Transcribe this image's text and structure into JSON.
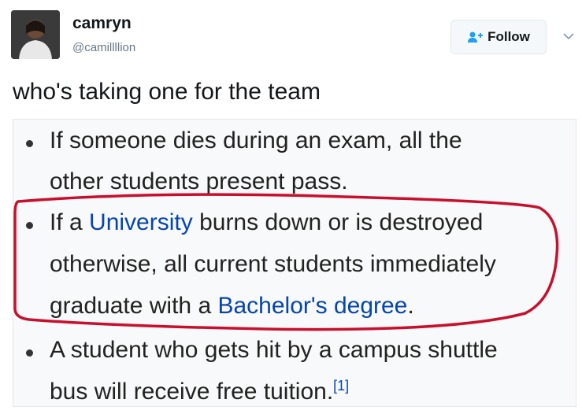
{
  "user": {
    "name": "camryn",
    "handle": "@camillllion"
  },
  "follow_label": "Follow",
  "tweet_text": "who's taking one for the team",
  "icons": {
    "follow": "add-person-icon",
    "menu": "chevron-down-icon"
  },
  "colors": {
    "link": "#0645ad",
    "circle": "#c8102e",
    "handle": "#657786"
  },
  "wiki_items": [
    {
      "line1": "If someone dies during an exam, all the",
      "line2": "other students present pass."
    },
    {
      "line1_prefix": "If a ",
      "line1_link": "University",
      "line1_suffix": " burns down or is destroyed",
      "line2": "otherwise, all current students immediately",
      "line3_prefix": "graduate with a ",
      "line3_link": "Bachelor's degree",
      "line3_suffix": "."
    },
    {
      "line1": "A student who gets hit by a campus shuttle",
      "line2": "bus will receive free tuition.",
      "citation": "[1]"
    }
  ]
}
